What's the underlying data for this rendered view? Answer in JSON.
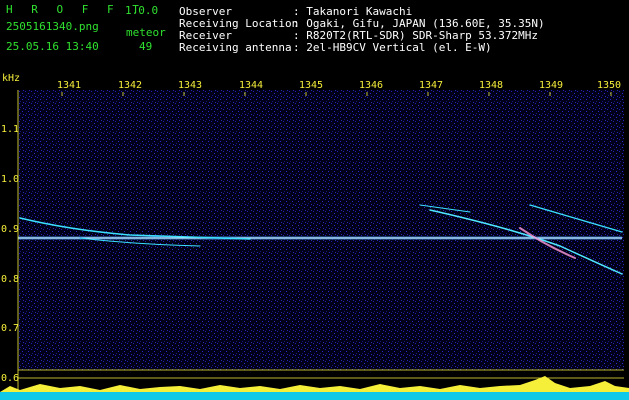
{
  "header": {
    "app_title": "H R O F F T",
    "version": "1.0.0",
    "filename": "2505161340.png",
    "datetime": "25.05.16 13:40",
    "meteor_label": "meteor",
    "meteor_count": "49"
  },
  "info": {
    "rows": [
      {
        "label": "Observer",
        "value": ": Takanori Kawachi"
      },
      {
        "label": "Receiving Location",
        "value": ": Ogaki, Gifu, JAPAN (136.60E, 35.35N)"
      },
      {
        "label": "Receiver",
        "value": ": R820T2(RTL-SDR) SDR-Sharp 53.372MHz"
      },
      {
        "label": "Receiving antenna",
        "value": ": 2el-HB9CV Vertical (el. E-W)"
      }
    ]
  },
  "plot": {
    "y_unit": "kHz",
    "x_ticks": [
      "1341",
      "1342",
      "1343",
      "1344",
      "1345",
      "1346",
      "1347",
      "1348",
      "1349",
      "1350"
    ],
    "y_ticks": [
      "1.1",
      "1.0",
      "0.9",
      "0.8",
      "0.7",
      "0.6"
    ],
    "colors": {
      "axis_text": "#f6ef3a",
      "header_text": "#2fe02f",
      "info_text": "#ffffff",
      "carrier": "#c8f0ff",
      "noise": "#1a1aa8",
      "meteor": "#33d6ff",
      "baseline": "#f6ef3a",
      "base_line_cyan": "#2ad4ff"
    }
  }
}
